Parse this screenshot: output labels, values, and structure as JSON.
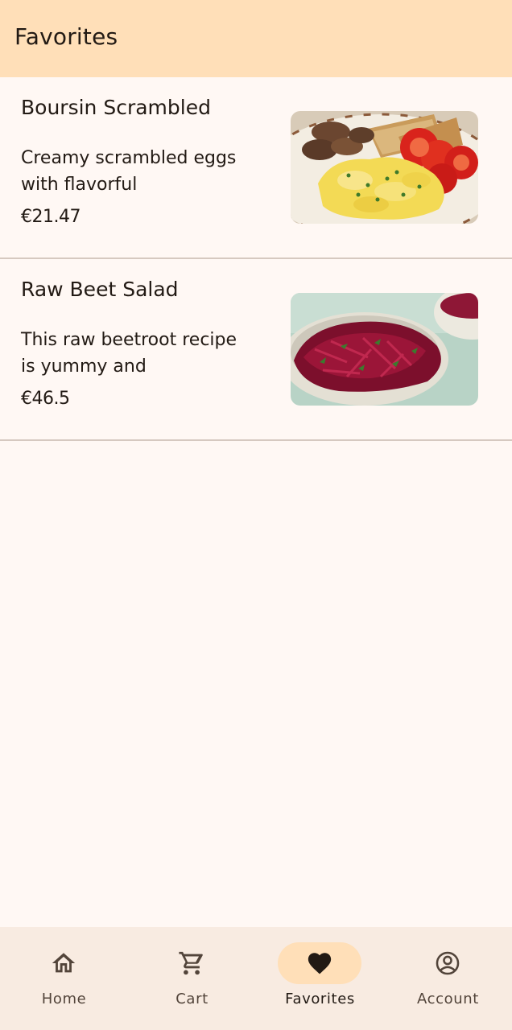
{
  "header": {
    "title": "Favorites"
  },
  "favorites": [
    {
      "name": "Boursin Scrambled",
      "description": "Creamy scrambled eggs with flavorful",
      "price": "€21.47",
      "image": "scrambled-eggs-photo"
    },
    {
      "name": "Raw Beet Salad",
      "description": "This raw beetroot recipe is yummy and",
      "price": "€46.5",
      "image": "beet-salad-photo"
    }
  ],
  "nav": {
    "items": [
      {
        "label": "Home",
        "icon": "home-icon",
        "active": false
      },
      {
        "label": "Cart",
        "icon": "cart-icon",
        "active": false
      },
      {
        "label": "Favorites",
        "icon": "heart-icon",
        "active": true
      },
      {
        "label": "Account",
        "icon": "account-circle-icon",
        "active": false
      }
    ]
  },
  "colors": {
    "header_bg": "#ffdfb8",
    "page_bg": "#fff8f4",
    "nav_bg": "#f8ebe1",
    "active_indicator": "#ffdfb8",
    "text": "#221a14",
    "divider": "#d6c9c0"
  }
}
